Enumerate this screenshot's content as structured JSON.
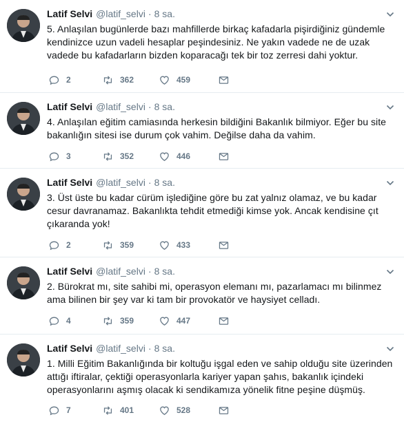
{
  "colors": {
    "text": "#14171a",
    "muted": "#657786",
    "divider": "#e6ecf0"
  },
  "icons": {
    "reply": "reply-icon",
    "retweet": "retweet-icon",
    "like": "heart-icon",
    "dm": "envelope-icon",
    "menu": "chevron-down-icon"
  },
  "tweets": [
    {
      "name": "Latif Selvi",
      "handle": "@latif_selvi",
      "separator": "·",
      "time": "8 sa.",
      "text": "5. Anlaşılan bugünlerde bazı mahfillerde birkaç kafadarla pişirdiğiniz gündemle kendinizce uzun vadeli hesaplar peşindesiniz. Ne yakın vadede ne de uzak vadede bu kafadarların bizden koparacağı tek bir toz zerresi dahi yoktur.",
      "replies": "2",
      "retweets": "362",
      "likes": "459"
    },
    {
      "name": "Latif Selvi",
      "handle": "@latif_selvi",
      "separator": "·",
      "time": "8 sa.",
      "text": "4. Anlaşılan eğitim camiasında herkesin bildiğini Bakanlık bilmiyor. Eğer bu site bakanlığın sitesi ise durum çok vahim. Değilse daha da vahim.",
      "replies": "3",
      "retweets": "352",
      "likes": "446"
    },
    {
      "name": "Latif Selvi",
      "handle": "@latif_selvi",
      "separator": "·",
      "time": "8 sa.",
      "text": "3. Üst üste bu kadar cürüm işlediğine göre bu zat yalnız olamaz, ve bu kadar cesur davranamaz. Bakanlıkta tehdit etmediği kimse yok. Ancak kendisine çıt çıkaranda yok!",
      "replies": "2",
      "retweets": "359",
      "likes": "433"
    },
    {
      "name": "Latif Selvi",
      "handle": "@latif_selvi",
      "separator": "·",
      "time": "8 sa.",
      "text": "2. Bürokrat mı, site sahibi mi, operasyon elemanı mı, pazarlamacı mı bilinmez ama bilinen bir şey var ki tam bir provokatör ve haysiyet celladı.",
      "replies": "4",
      "retweets": "359",
      "likes": "447"
    },
    {
      "name": "Latif Selvi",
      "handle": "@latif_selvi",
      "separator": "·",
      "time": "8 sa.",
      "text": "1. Milli Eğitim Bakanlığında bir koltuğu işgal eden ve sahip olduğu site üzerinden attığı iftiralar, çektiği operasyonlarla kariyer yapan şahıs, bakanlık içindeki operasyonlarını aşmış olacak ki sendikamıza yönelik fitne peşine düşmüş.",
      "replies": "7",
      "retweets": "401",
      "likes": "528"
    }
  ]
}
